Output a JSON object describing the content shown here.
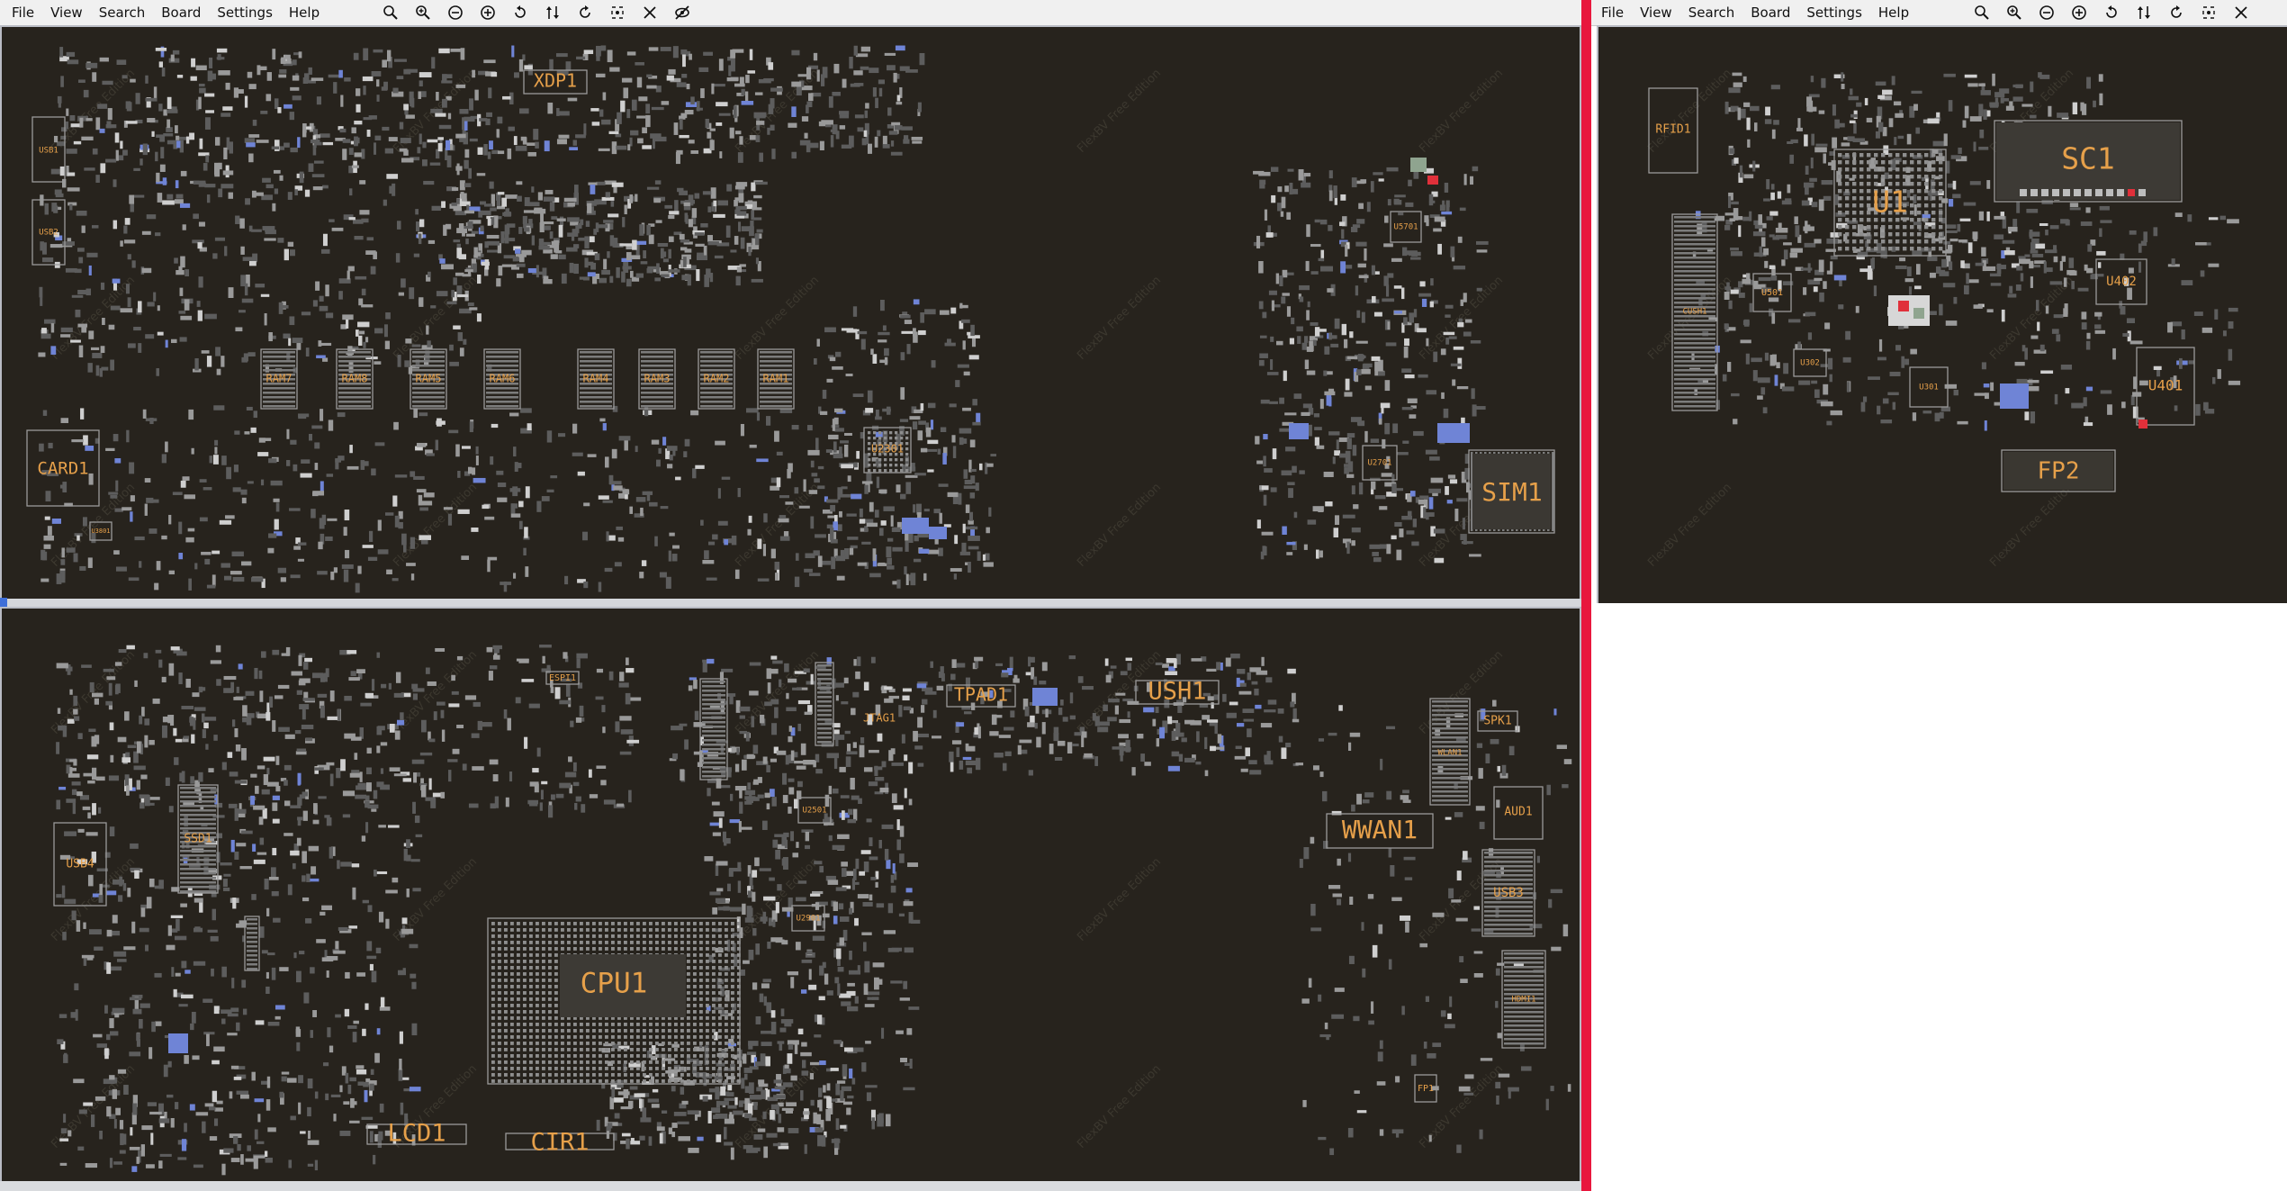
{
  "menu": [
    "File",
    "View",
    "Search",
    "Board",
    "Settings",
    "Help"
  ],
  "colors": {
    "board": "#27231d",
    "label": "#e6a04a",
    "part": "#5d5d5d",
    "part_light": "#9a9a9a",
    "blue": "#6f84d6",
    "red": "#e0303a",
    "divider": "#e8173d"
  },
  "toolbar_main": [
    "zoom-fit-icon",
    "zoom-in-icon",
    "zoom-out-icon",
    "zoom-reset-icon",
    "rotate-ccw-icon",
    "flip-icon",
    "rotate-cw-icon",
    "fullscreen-icon",
    "close-icon",
    "hide-icon"
  ],
  "toolbar_secondary": [
    "zoom-fit-icon",
    "zoom-in-icon",
    "zoom-out-icon",
    "zoom-reset-icon",
    "rotate-ccw-icon",
    "flip-icon",
    "rotate-cw-icon",
    "fullscreen-icon",
    "close-icon"
  ],
  "watermark": "FlexBV Free Edition",
  "top_board": {
    "labels": [
      "XDP1",
      "USB1",
      "USB2",
      "CARD1",
      "RAM7",
      "RAM8",
      "RAM5",
      "RAM6",
      "RAM4",
      "RAM3",
      "RAM2",
      "RAM1",
      "U2301",
      "U5701",
      "U2701",
      "SIM1",
      "U3801"
    ]
  },
  "bottom_board": {
    "labels": [
      "TPAD1",
      "USH1",
      "JTAG1",
      "ESPI1",
      "SSD1",
      "USB4",
      "CPU1",
      "LCD1",
      "CIR1",
      "WWAN1",
      "WLAN1",
      "SPK1",
      "AUD1",
      "USB3",
      "HDMI1",
      "FP1",
      "U2501",
      "U2901"
    ]
  },
  "right_board": {
    "labels": [
      "RFID1",
      "SC1",
      "U1",
      "CUSH1",
      "U501",
      "U402",
      "U302",
      "U301",
      "U401",
      "FP2"
    ]
  }
}
